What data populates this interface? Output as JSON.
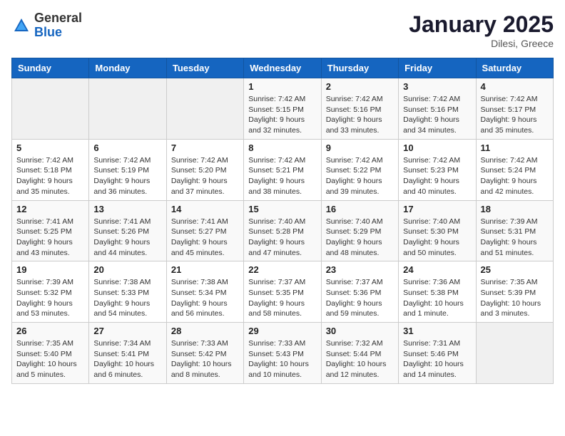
{
  "header": {
    "logo_general": "General",
    "logo_blue": "Blue",
    "month_title": "January 2025",
    "location": "Dilesi, Greece"
  },
  "weekdays": [
    "Sunday",
    "Monday",
    "Tuesday",
    "Wednesday",
    "Thursday",
    "Friday",
    "Saturday"
  ],
  "weeks": [
    [
      {
        "day": "",
        "info": ""
      },
      {
        "day": "",
        "info": ""
      },
      {
        "day": "",
        "info": ""
      },
      {
        "day": "1",
        "info": "Sunrise: 7:42 AM\nSunset: 5:15 PM\nDaylight: 9 hours and 32 minutes."
      },
      {
        "day": "2",
        "info": "Sunrise: 7:42 AM\nSunset: 5:16 PM\nDaylight: 9 hours and 33 minutes."
      },
      {
        "day": "3",
        "info": "Sunrise: 7:42 AM\nSunset: 5:16 PM\nDaylight: 9 hours and 34 minutes."
      },
      {
        "day": "4",
        "info": "Sunrise: 7:42 AM\nSunset: 5:17 PM\nDaylight: 9 hours and 35 minutes."
      }
    ],
    [
      {
        "day": "5",
        "info": "Sunrise: 7:42 AM\nSunset: 5:18 PM\nDaylight: 9 hours and 35 minutes."
      },
      {
        "day": "6",
        "info": "Sunrise: 7:42 AM\nSunset: 5:19 PM\nDaylight: 9 hours and 36 minutes."
      },
      {
        "day": "7",
        "info": "Sunrise: 7:42 AM\nSunset: 5:20 PM\nDaylight: 9 hours and 37 minutes."
      },
      {
        "day": "8",
        "info": "Sunrise: 7:42 AM\nSunset: 5:21 PM\nDaylight: 9 hours and 38 minutes."
      },
      {
        "day": "9",
        "info": "Sunrise: 7:42 AM\nSunset: 5:22 PM\nDaylight: 9 hours and 39 minutes."
      },
      {
        "day": "10",
        "info": "Sunrise: 7:42 AM\nSunset: 5:23 PM\nDaylight: 9 hours and 40 minutes."
      },
      {
        "day": "11",
        "info": "Sunrise: 7:42 AM\nSunset: 5:24 PM\nDaylight: 9 hours and 42 minutes."
      }
    ],
    [
      {
        "day": "12",
        "info": "Sunrise: 7:41 AM\nSunset: 5:25 PM\nDaylight: 9 hours and 43 minutes."
      },
      {
        "day": "13",
        "info": "Sunrise: 7:41 AM\nSunset: 5:26 PM\nDaylight: 9 hours and 44 minutes."
      },
      {
        "day": "14",
        "info": "Sunrise: 7:41 AM\nSunset: 5:27 PM\nDaylight: 9 hours and 45 minutes."
      },
      {
        "day": "15",
        "info": "Sunrise: 7:40 AM\nSunset: 5:28 PM\nDaylight: 9 hours and 47 minutes."
      },
      {
        "day": "16",
        "info": "Sunrise: 7:40 AM\nSunset: 5:29 PM\nDaylight: 9 hours and 48 minutes."
      },
      {
        "day": "17",
        "info": "Sunrise: 7:40 AM\nSunset: 5:30 PM\nDaylight: 9 hours and 50 minutes."
      },
      {
        "day": "18",
        "info": "Sunrise: 7:39 AM\nSunset: 5:31 PM\nDaylight: 9 hours and 51 minutes."
      }
    ],
    [
      {
        "day": "19",
        "info": "Sunrise: 7:39 AM\nSunset: 5:32 PM\nDaylight: 9 hours and 53 minutes."
      },
      {
        "day": "20",
        "info": "Sunrise: 7:38 AM\nSunset: 5:33 PM\nDaylight: 9 hours and 54 minutes."
      },
      {
        "day": "21",
        "info": "Sunrise: 7:38 AM\nSunset: 5:34 PM\nDaylight: 9 hours and 56 minutes."
      },
      {
        "day": "22",
        "info": "Sunrise: 7:37 AM\nSunset: 5:35 PM\nDaylight: 9 hours and 58 minutes."
      },
      {
        "day": "23",
        "info": "Sunrise: 7:37 AM\nSunset: 5:36 PM\nDaylight: 9 hours and 59 minutes."
      },
      {
        "day": "24",
        "info": "Sunrise: 7:36 AM\nSunset: 5:38 PM\nDaylight: 10 hours and 1 minute."
      },
      {
        "day": "25",
        "info": "Sunrise: 7:35 AM\nSunset: 5:39 PM\nDaylight: 10 hours and 3 minutes."
      }
    ],
    [
      {
        "day": "26",
        "info": "Sunrise: 7:35 AM\nSunset: 5:40 PM\nDaylight: 10 hours and 5 minutes."
      },
      {
        "day": "27",
        "info": "Sunrise: 7:34 AM\nSunset: 5:41 PM\nDaylight: 10 hours and 6 minutes."
      },
      {
        "day": "28",
        "info": "Sunrise: 7:33 AM\nSunset: 5:42 PM\nDaylight: 10 hours and 8 minutes."
      },
      {
        "day": "29",
        "info": "Sunrise: 7:33 AM\nSunset: 5:43 PM\nDaylight: 10 hours and 10 minutes."
      },
      {
        "day": "30",
        "info": "Sunrise: 7:32 AM\nSunset: 5:44 PM\nDaylight: 10 hours and 12 minutes."
      },
      {
        "day": "31",
        "info": "Sunrise: 7:31 AM\nSunset: 5:46 PM\nDaylight: 10 hours and 14 minutes."
      },
      {
        "day": "",
        "info": ""
      }
    ]
  ]
}
